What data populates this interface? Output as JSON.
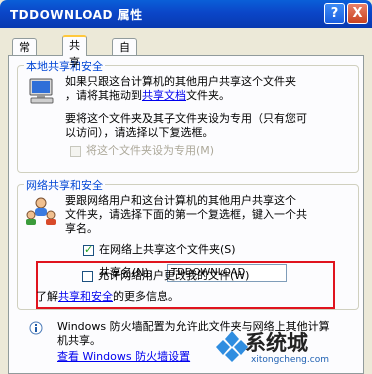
{
  "window": {
    "title": "TDDOWNLOAD 属性",
    "help": "?",
    "close": "X"
  },
  "tabs": [
    "常规",
    "共享",
    "自定义"
  ],
  "local": {
    "group_label": "本地共享和安全",
    "line1": "如果只跟这台计算机的其他用户共享这个文件夹",
    "line2_prefix": "，请将其拖动到",
    "line2_link": "共享文档",
    "line2_suffix": "文件夹。",
    "line3": "要将这个文件夹及其子文件夹设为专用（只有您可",
    "line4": "以访问），请选择以下复选框。",
    "private_label": "将这个文件夹设为专用(M)"
  },
  "network": {
    "group_label": "网络共享和安全",
    "line1": "要跟网络用户和这台计算机的其他用户共享这个",
    "line2": "文件夹，请选择下面的第一个复选框，键入一个共",
    "line3": "享名。",
    "share_label": "在网络上共享这个文件夹(S)",
    "share_name_label": "共享名(N):",
    "share_name_value": "TDDOWNLOAD",
    "allow_change_label": "允许网络用户更改我的文件(W)",
    "learn_prefix": "了解",
    "learn_link": "共享和安全",
    "learn_suffix": "的更多信息。"
  },
  "firewall": {
    "line1": "Windows 防火墙配置为允许此文件夹与网络上其他计算",
    "line2": "机共享。",
    "link": "查看 Windows 防火墙设置"
  },
  "watermark": {
    "text": "系统城",
    "url": "xitongcheng.com"
  }
}
